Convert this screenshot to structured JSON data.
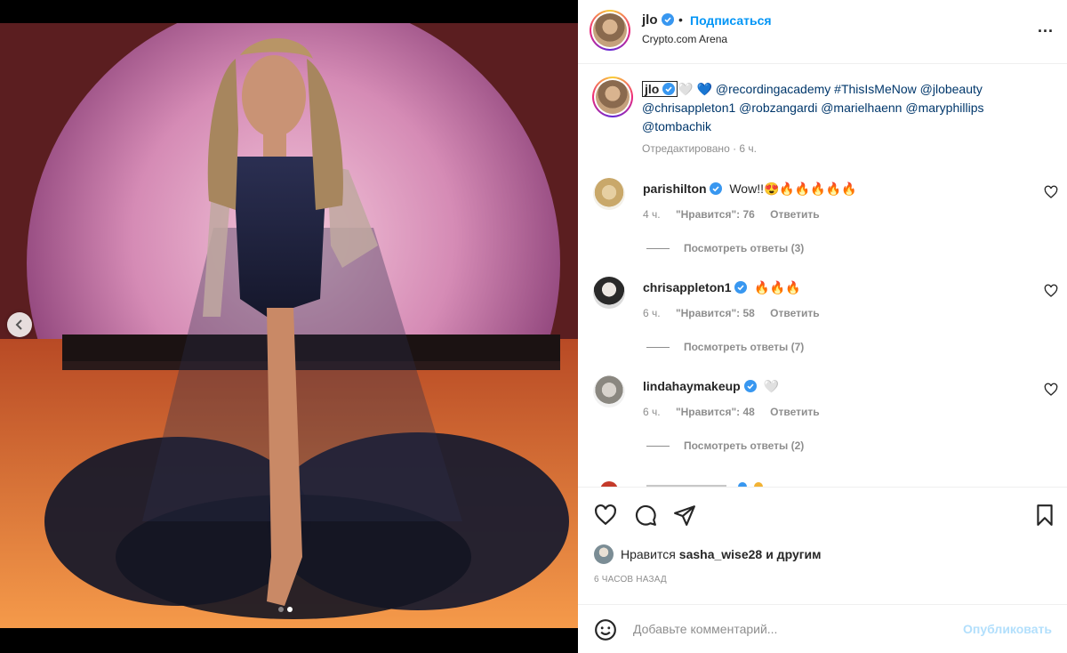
{
  "media": {
    "carousel_dots": 2,
    "active_dot": 1
  },
  "header": {
    "username": "jlo",
    "separator": "•",
    "follow_label": "Подписаться",
    "location": "Crypto.com Arena",
    "more_label": "..."
  },
  "caption": {
    "username": "jlo",
    "emoji_1": "🤍",
    "emoji_2": "💙",
    "text_line_1": "@recordingacademy #ThisIsMeNow @jlobeauty",
    "text_line_2": "@chrisappleton1 @robzangardi @marielhaenn @maryphillips",
    "text_line_3": "@tombachik",
    "meta": "Отредактировано · 6 ч."
  },
  "comments": [
    {
      "username": "parishilton",
      "text": "Wow!!😍🔥🔥🔥🔥🔥",
      "time": "4 ч.",
      "likes": "\"Нравится\": 76",
      "reply": "Ответить",
      "replies": "Посмотреть ответы (3)"
    },
    {
      "username": "chrisappleton1",
      "text": "🔥🔥🔥",
      "time": "6 ч.",
      "likes": "\"Нравится\": 58",
      "reply": "Ответить",
      "replies": "Посмотреть ответы (7)"
    },
    {
      "username": "lindahaymakeup",
      "text": "🤍",
      "time": "6 ч.",
      "likes": "\"Нравится\": 48",
      "reply": "Ответить",
      "replies": "Посмотреть ответы (2)"
    }
  ],
  "actions": {
    "liked_by_prefix": "Нравится",
    "liked_by_user": "sasha_wise28",
    "liked_by_suffix": "и другим",
    "time_ago": "6 ЧАСОВ НАЗАД"
  },
  "add_comment": {
    "placeholder": "Добавьте комментарий...",
    "publish_label": "Опубликовать"
  },
  "colors": {
    "accent": "#0095f6",
    "verified": "#3897f0",
    "muted": "#8e8e8e"
  }
}
